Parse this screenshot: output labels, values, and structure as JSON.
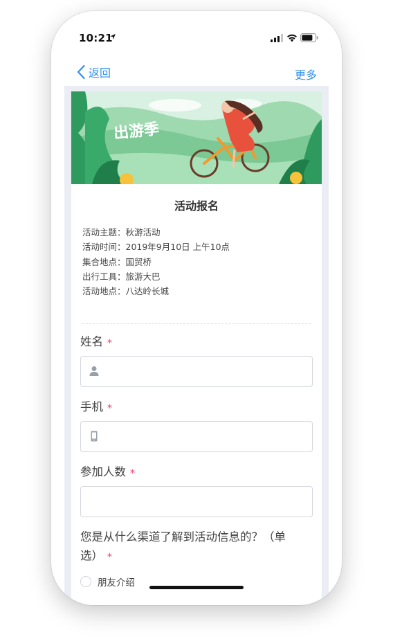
{
  "status_bar": {
    "time": "10:21"
  },
  "nav": {
    "back_label": "返回",
    "more_label": "更多"
  },
  "banner": {
    "text": "出游季"
  },
  "form": {
    "title": "活动报名",
    "info": [
      "活动主题：秋游活动",
      "活动时间：2019年9月10日 上午10点",
      "集合地点：国贸桥",
      "出行工具：旅游大巴",
      "活动地点：八达岭长城"
    ],
    "fields": {
      "name": {
        "label": "姓名",
        "required": "*",
        "value": ""
      },
      "phone": {
        "label": "手机",
        "required": "*",
        "value": ""
      },
      "count": {
        "label": "参加人数",
        "required": "*",
        "value": ""
      }
    },
    "question": {
      "label_line1": "您是从什么渠道了解到活动信息的？（单",
      "label_line2": "选）",
      "required": "*",
      "options": [
        "朋友介绍"
      ]
    }
  },
  "colors": {
    "accent": "#2f8ff0",
    "required": "#f0426b",
    "background": "#eaedf4"
  },
  "icons": [
    "location-arrow-icon",
    "signal-icon",
    "wifi-icon",
    "battery-icon",
    "chevron-left-icon",
    "user-icon",
    "mobile-icon"
  ]
}
